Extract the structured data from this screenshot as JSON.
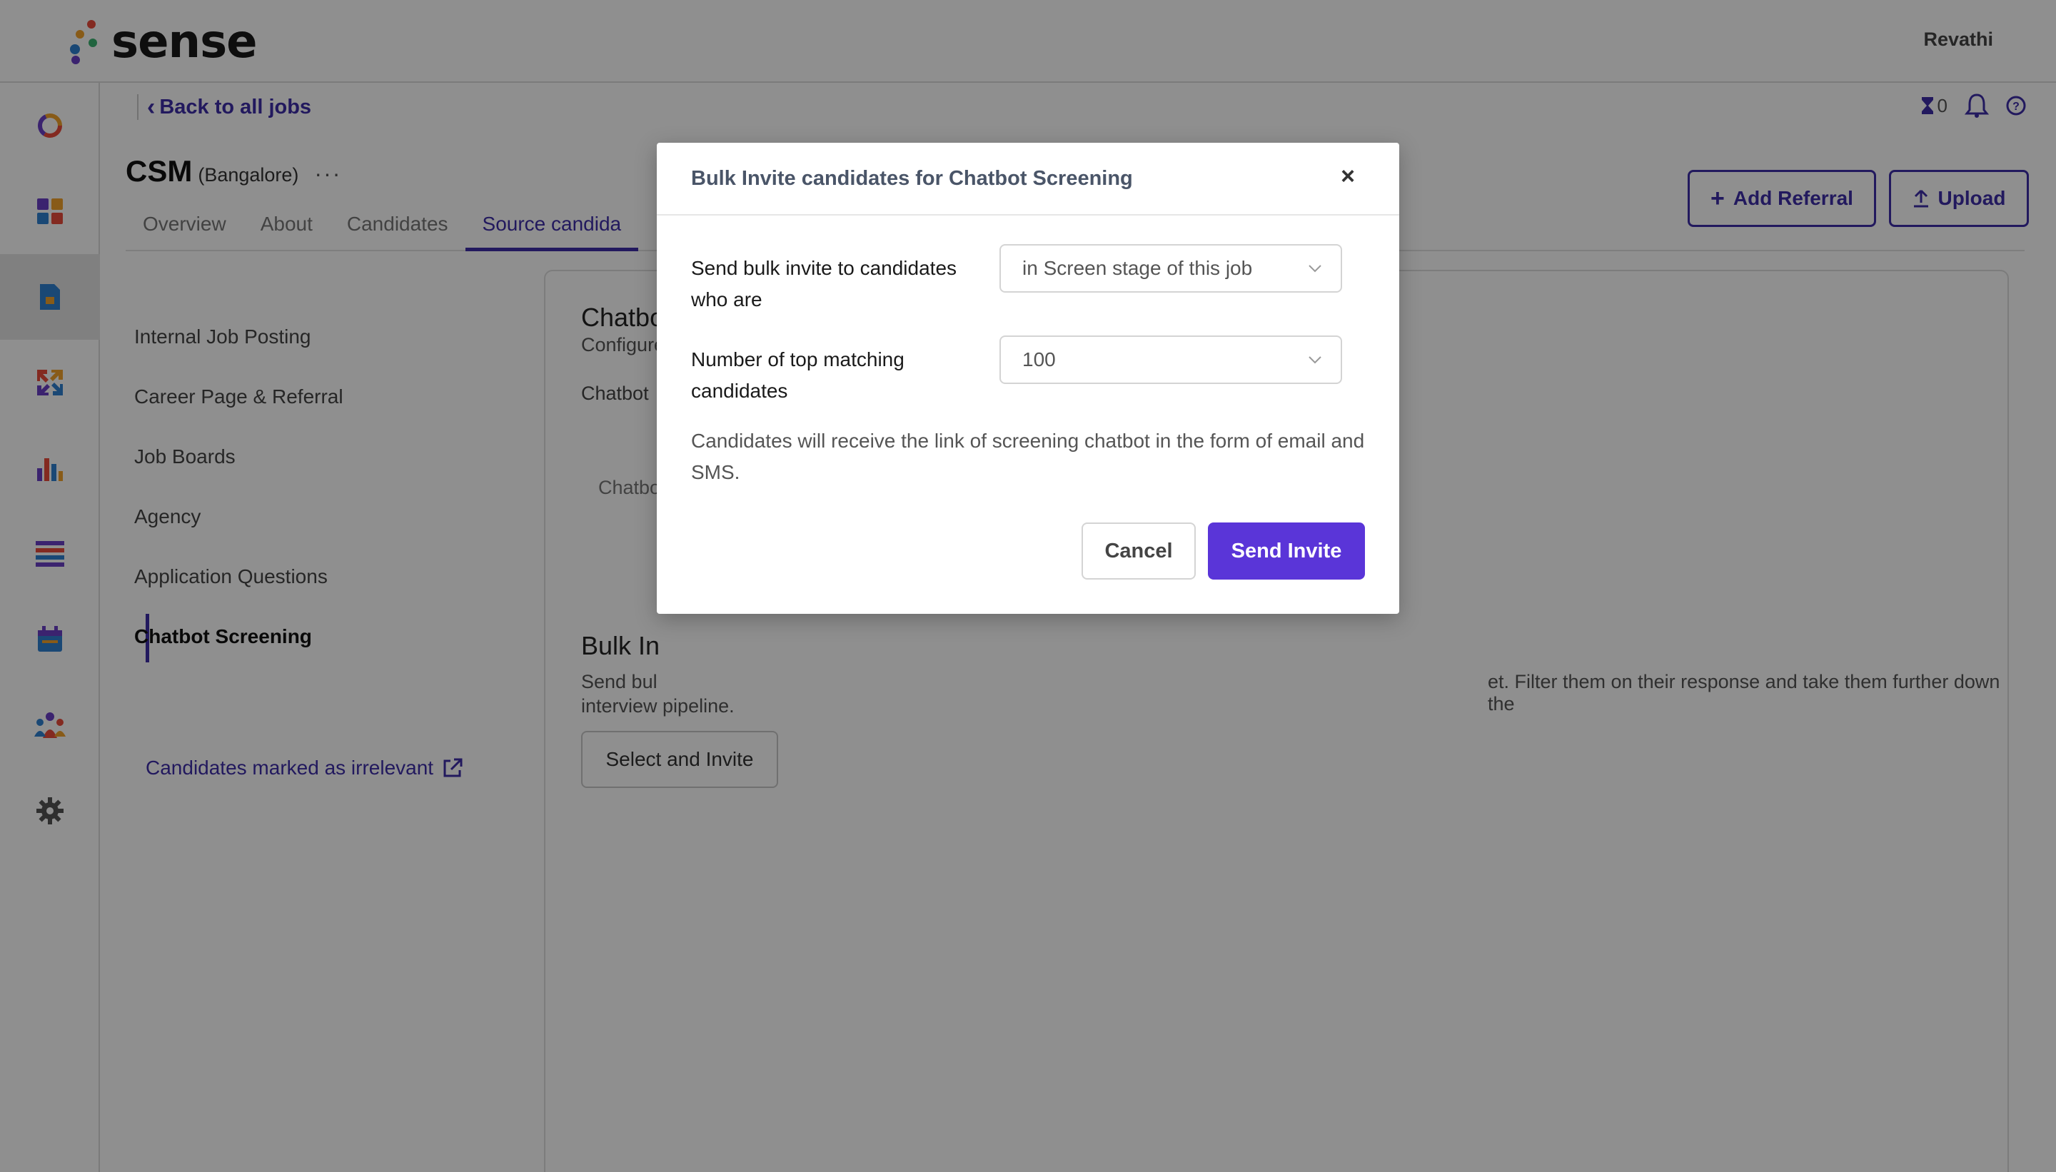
{
  "app": {
    "brand": "sense",
    "user_name": "Revathi"
  },
  "header": {
    "back_label": "Back to all jobs",
    "pending_count": "0"
  },
  "job": {
    "title": "CSM",
    "location": "(Bangalore)",
    "more": "···"
  },
  "tabs": [
    {
      "label": "Overview"
    },
    {
      "label": "About"
    },
    {
      "label": "Candidates"
    },
    {
      "label": "Source candida"
    }
  ],
  "actions": {
    "add_referral": "Add Referral",
    "upload": "Upload"
  },
  "source_menu": {
    "items": [
      {
        "label": "Internal Job Posting"
      },
      {
        "label": "Career Page & Referral"
      },
      {
        "label": "Job Boards"
      },
      {
        "label": "Agency"
      },
      {
        "label": "Application Questions"
      },
      {
        "label": "Chatbot Screening"
      }
    ],
    "irrelevant_link": "Candidates marked as irrelevant"
  },
  "content": {
    "chatbot_heading": "Chatbo",
    "configure_text": "Configure",
    "chatbot_label": "Chatbot",
    "chatbot_tab": "Chatbo",
    "bulk_heading": "Bulk In",
    "bulk_desc_left": "Send bul",
    "bulk_desc_right": "et. Filter them on their response and take them further down the",
    "bulk_desc_line2": "interview pipeline.",
    "select_invite": "Select and Invite"
  },
  "modal": {
    "title": "Bulk Invite candidates for Chatbot Screening",
    "close": "×",
    "field1_label": "Send bulk invite to candidates who are",
    "field1_value": "in Screen stage of this job",
    "field2_label": "Number of top matching candidates",
    "field2_value": "100",
    "note": "Candidates will receive the link of screening chatbot in the form of email and SMS.",
    "cancel": "Cancel",
    "send": "Send Invite"
  },
  "colors": {
    "accent": "#3e2ea8",
    "primary_button": "#5a35d8"
  }
}
